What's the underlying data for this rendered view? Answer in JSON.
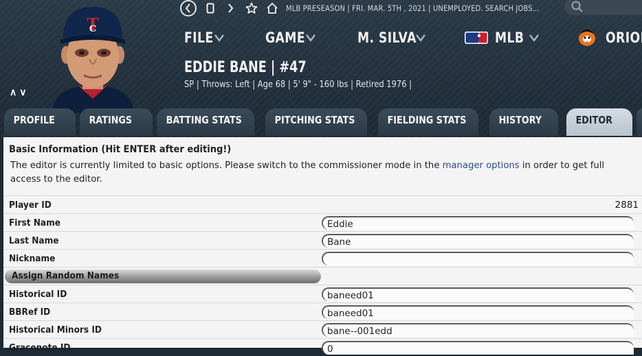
{
  "topbar": {
    "status": "MLB PRESEASON  |  FRI. MAR. 5TH , 2021  |  UNEMPLOYED. SEARCH JOBS..."
  },
  "menu": {
    "file": "FILE",
    "game": "GAME",
    "manager": "M. SILVA",
    "league": "MLB",
    "team": "ORIOL"
  },
  "player": {
    "name": "EDDIE BANE  |  #47",
    "info": "SP | Throws: Left  |  Age 68  |  5' 9\" - 160 lbs  |  Retired 1976  |"
  },
  "tabs": [
    "PROFILE",
    "RATINGS",
    "BATTING STATS",
    "PITCHING STATS",
    "FIELDING STATS",
    "HISTORY",
    "EDITOR"
  ],
  "editor": {
    "title": "Basic Information (Hit ENTER after editing!)",
    "desc_before": "The editor is currently limited to basic options. Please switch to the commissioner mode in the ",
    "desc_link": "manager options",
    "desc_after": " in order to get full access to the editor.",
    "player_id_label": "Player ID",
    "player_id": "2881",
    "first_name_label": "First Name",
    "first_name": "Eddie",
    "last_name_label": "Last Name",
    "last_name": "Bane",
    "nickname_label": "Nickname",
    "nickname": "",
    "assign_button": "Assign Random Names",
    "historical_id_label": "Historical ID",
    "historical_id": "baneed01",
    "bbref_id_label": "BBRef ID",
    "bbref_id": "baneed01",
    "hist_minors_label": "Historical Minors ID",
    "hist_minors": "bane--001edd",
    "gracenote_label": "Gracenote ID",
    "gracenote": "0"
  },
  "colors": {
    "header_bg": "#22313d",
    "tab_bg": "#34434f",
    "tab_active_bg": "#c8d0d8",
    "content_bg": "#f4f4f4",
    "link": "#2b4b8a",
    "orioles_orange": "#e8741e"
  }
}
